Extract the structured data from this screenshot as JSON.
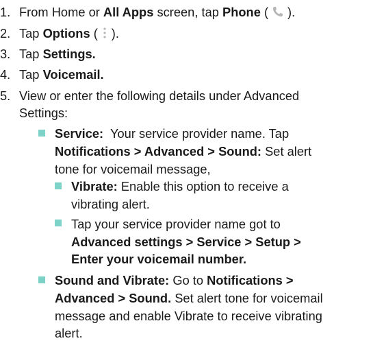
{
  "colors": {
    "text": "#1a1a1a",
    "bullet": "#7ed3c9",
    "icon": "#b5b5b5"
  },
  "steps": [
    {
      "number": "1.",
      "prefix": "From Home or ",
      "bold1": "All Apps",
      "mid": " screen, tap ",
      "bold2": "Phone",
      "open": " (",
      "icon": "phone-icon",
      "close": ")."
    },
    {
      "number": "2.",
      "prefix": "Tap ",
      "bold": "Options",
      "open": " (",
      "icon": "options-icon",
      "close": ")."
    },
    {
      "number": "3.",
      "prefix": "Tap ",
      "bold": "Settings."
    },
    {
      "number": "4.",
      "prefix": "Tap ",
      "bold": "Voicemail."
    },
    {
      "number": "5.",
      "line1": "View or enter the following details under Advanced",
      "line2": "Settings:"
    }
  ],
  "service": {
    "label": "Service:",
    "line1_rest": "  Your service provider name. Tap",
    "line2_bold": "Notifications > Advanced > Sound:",
    "line2_rest": " Set alert",
    "line3": "tone for voicemail message,"
  },
  "vibrate": {
    "label": "Vibrate:",
    "line1_rest": " Enable this option to receive a",
    "line2": "vibrating alert."
  },
  "provider": {
    "line1": "Tap your service provider name got to",
    "line2": "Advanced settings > Service > Setup >",
    "line3": "Enter your voicemail number."
  },
  "sound_vibrate": {
    "label": "Sound and Vibrate:",
    "line1_mid": " Go to ",
    "line1_bold": "Notifications >",
    "line2_bold": "Advanced > Sound.",
    "line2_rest": " Set alert tone for voicemail",
    "line3": "message and enable Vibrate to receive vibrating",
    "line4": "alert."
  }
}
